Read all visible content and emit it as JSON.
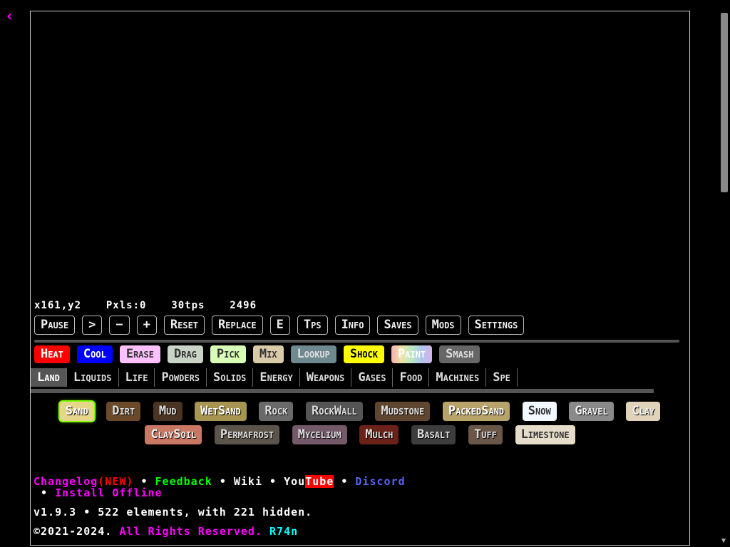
{
  "nav": {
    "back_glyph": "‹"
  },
  "stats": {
    "coords": "x161,y2",
    "pixels": "Pxls:0",
    "tps": "30tps",
    "count": "2496"
  },
  "controls": [
    "Pause",
    ">",
    "−",
    "+",
    "Reset",
    "Replace",
    "E",
    "Tps",
    "Info",
    "Saves",
    "Mods",
    "Settings"
  ],
  "tools": [
    {
      "label": "Heat",
      "bg": "#ff0000",
      "fg": "#ffffff"
    },
    {
      "label": "Cool",
      "bg": "#0000ff",
      "fg": "#ffffff"
    },
    {
      "label": "Erase",
      "bg": "#ffc0ff",
      "fg": "#333333"
    },
    {
      "label": "Drag",
      "bg": "#c9d3c6",
      "fg": "#333333"
    },
    {
      "label": "Pick",
      "bg": "#d7ffb8",
      "fg": "#333333"
    },
    {
      "label": "Mix",
      "bg": "#d9caa8",
      "fg": "#333333"
    },
    {
      "label": "Lookup",
      "bg": "#6e8a90",
      "fg": "#dddddd"
    },
    {
      "label": "Shock",
      "bg": "#ffff00",
      "fg": "#000000"
    },
    {
      "label": "Paint",
      "bg": "#e9b2c6",
      "fg": "#ffffff"
    },
    {
      "label": "Smash",
      "bg": "#666666",
      "fg": "#dddddd"
    }
  ],
  "categories": [
    "Land",
    "Liquids",
    "Life",
    "Powders",
    "Solids",
    "Energy",
    "Weapons",
    "Gases",
    "Food",
    "Machines",
    "Spe"
  ],
  "elements": [
    {
      "label": "Sand",
      "bg": "#e6d68a",
      "fg": "#ffffff",
      "selected": true
    },
    {
      "label": "Dirt",
      "bg": "#6b4a2b",
      "fg": "#dddddd"
    },
    {
      "label": "Mud",
      "bg": "#4a3424",
      "fg": "#dddddd"
    },
    {
      "label": "WetSand",
      "bg": "#a89551",
      "fg": "#ffffff"
    },
    {
      "label": "Rock",
      "bg": "#6a6a6a",
      "fg": "#dddddd"
    },
    {
      "label": "RockWall",
      "bg": "#555555",
      "fg": "#dddddd"
    },
    {
      "label": "Mudstone",
      "bg": "#5f4630",
      "fg": "#dddddd"
    },
    {
      "label": "PackedSand",
      "bg": "#b8a46a",
      "fg": "#ffffff"
    },
    {
      "label": "Snow",
      "bg": "#f2f8ff",
      "fg": "#333333"
    },
    {
      "label": "Gravel",
      "bg": "#8a8a8a",
      "fg": "#eeeeee"
    },
    {
      "label": "Clay",
      "bg": "#e0d3b9",
      "fg": "#eeeeee"
    },
    {
      "label": "ClaySoil",
      "bg": "#c97864",
      "fg": "#eeeeee"
    },
    {
      "label": "Permafrost",
      "bg": "#5b544a",
      "fg": "#dddddd"
    },
    {
      "label": "Mycelium",
      "bg": "#745969",
      "fg": "#dddddd"
    },
    {
      "label": "Mulch",
      "bg": "#6a2219",
      "fg": "#dddddd"
    },
    {
      "label": "Basalt",
      "bg": "#3d3d3d",
      "fg": "#dddddd"
    },
    {
      "label": "Tuff",
      "bg": "#6b5747",
      "fg": "#dddddd"
    },
    {
      "label": "Limestone",
      "bg": "#e5dcc9",
      "fg": "#333333"
    }
  ],
  "footer": {
    "changelog": "Changelog",
    "changelog_new": "(NEW)",
    "feedback": "Feedback",
    "wiki": "Wiki",
    "youtube_a": "You",
    "youtube_b": "Tube",
    "discord": "Discord",
    "install": "Install Offline",
    "sep": "•"
  },
  "version": "v1.9.3 • 522 elements, with 221 hidden.",
  "copyright": {
    "prefix": "©2021-2024.",
    "rights": "All Rights Reserved.",
    "author": "R74n"
  },
  "colors": {
    "accent": "#ff00ff",
    "feedback": "#00ff00",
    "discord": "#5865f2",
    "youtube": "#ff0000",
    "author": "#00ffff"
  }
}
